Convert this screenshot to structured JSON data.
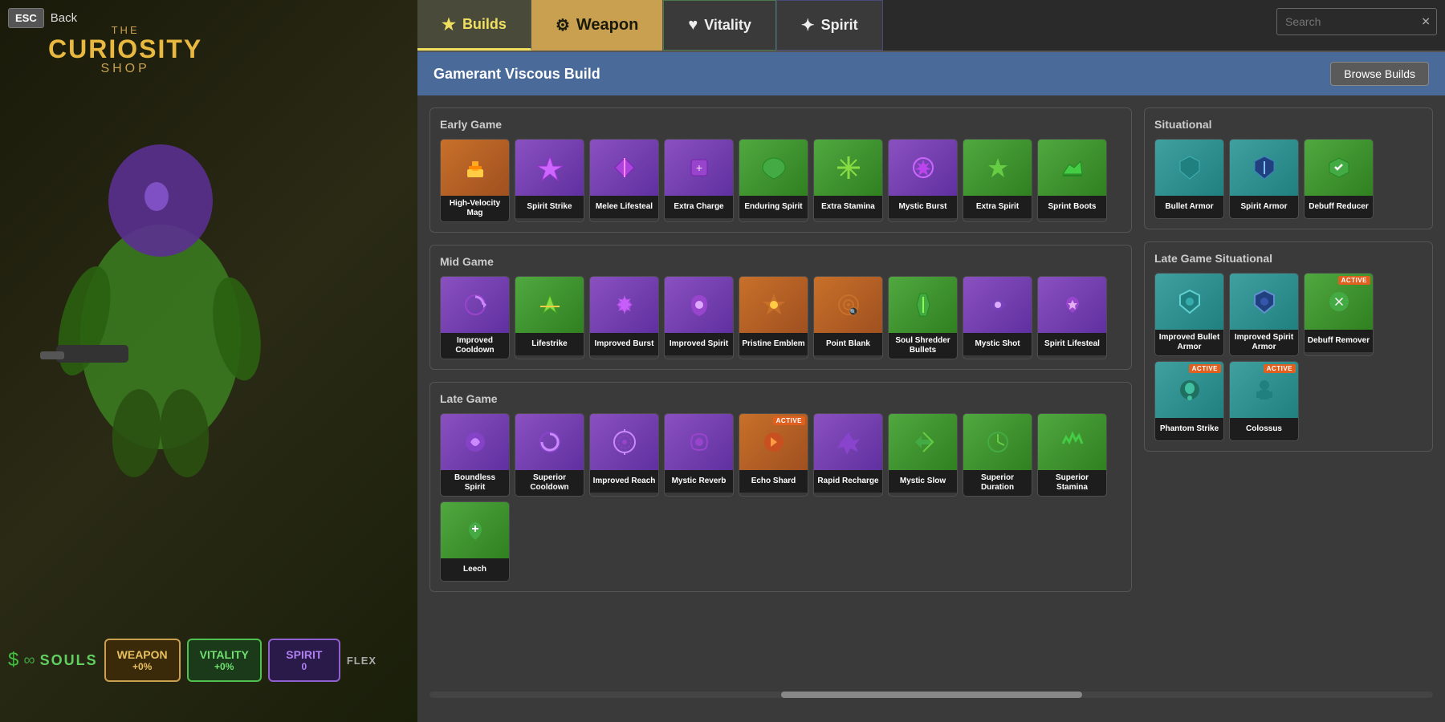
{
  "app": {
    "title": "The Curiosity Shop",
    "the_label": "THE",
    "curiosity_label": "CURIOSITY",
    "shop_label": "SHOP"
  },
  "top_bar": {
    "esc_label": "ESC",
    "back_label": "Back"
  },
  "tabs": {
    "builds_label": "Builds",
    "weapon_label": "Weapon",
    "vitality_label": "Vitality",
    "spirit_label": "Spirit"
  },
  "search": {
    "placeholder": "Search",
    "clear_icon": "✕"
  },
  "build": {
    "title": "Gamerant Viscous Build",
    "browse_builds_label": "Browse Builds"
  },
  "stats": {
    "souls_label": "SOULS",
    "weapon_label": "WEAPON",
    "weapon_val": "+0%",
    "vitality_label": "VITALITY",
    "vitality_val": "+0%",
    "spirit_label": "SPIRIT",
    "spirit_val": "0",
    "flex_label": "FLEX"
  },
  "sections": {
    "early_game_label": "Early Game",
    "mid_game_label": "Mid Game",
    "late_game_label": "Late Game",
    "situational_label": "Situational",
    "late_game_situational_label": "Late Game Situational"
  },
  "early_game_items": [
    {
      "name": "High-Velocity Mag",
      "color": "orange",
      "icon": "🔫"
    },
    {
      "name": "Spirit Strike",
      "color": "purple",
      "icon": "✦"
    },
    {
      "name": "Melee Lifesteal",
      "color": "purple",
      "icon": "⚔"
    },
    {
      "name": "Extra Charge",
      "color": "purple",
      "icon": "🔋"
    },
    {
      "name": "Enduring Spirit",
      "color": "green",
      "icon": "♥"
    },
    {
      "name": "Extra Stamina",
      "color": "green",
      "icon": "✱"
    },
    {
      "name": "Mystic Burst",
      "color": "purple",
      "icon": "✶"
    },
    {
      "name": "Extra Spirit",
      "color": "green",
      "icon": "✦"
    },
    {
      "name": "Sprint Boots",
      "color": "green",
      "icon": "👟"
    }
  ],
  "mid_game_items": [
    {
      "name": "Improved Cooldown",
      "color": "purple",
      "icon": "↺"
    },
    {
      "name": "Lifestrike",
      "color": "green",
      "icon": "⚡"
    },
    {
      "name": "Improved Burst",
      "color": "purple",
      "icon": "💫"
    },
    {
      "name": "Improved Spirit",
      "color": "purple",
      "icon": "🌀"
    },
    {
      "name": "Pristine Emblem",
      "color": "orange",
      "icon": "🛡"
    },
    {
      "name": "Point Blank",
      "color": "orange",
      "icon": "🎯"
    },
    {
      "name": "Soul Shredder Bullets",
      "color": "green",
      "icon": "🌿"
    },
    {
      "name": "Mystic Shot",
      "color": "purple",
      "icon": "☁"
    },
    {
      "name": "Spirit Lifesteal",
      "color": "purple",
      "icon": "💠"
    }
  ],
  "late_game_items": [
    {
      "name": "Boundless Spirit",
      "color": "purple",
      "icon": "🌸"
    },
    {
      "name": "Superior Cooldown",
      "color": "purple",
      "icon": "♾"
    },
    {
      "name": "Improved Reach",
      "color": "purple",
      "icon": "📡"
    },
    {
      "name": "Mystic Reverb",
      "color": "purple",
      "icon": "🎵"
    },
    {
      "name": "Echo Shard",
      "color": "orange",
      "icon": "💠",
      "active": true
    },
    {
      "name": "Rapid Recharge",
      "color": "purple",
      "icon": "⚡"
    },
    {
      "name": "Mystic Slow",
      "color": "green",
      "icon": "❄"
    },
    {
      "name": "Superior Duration",
      "color": "green",
      "icon": "⏱"
    },
    {
      "name": "Superior Stamina",
      "color": "green",
      "icon": "🌿"
    },
    {
      "name": "Leech",
      "color": "green",
      "icon": "🩸"
    }
  ],
  "situational_items": [
    {
      "name": "Bullet Armor",
      "color": "teal",
      "icon": "🛡"
    },
    {
      "name": "Spirit Armor",
      "color": "teal",
      "icon": "🛡"
    },
    {
      "name": "Debuff Reducer",
      "color": "green",
      "icon": "⬇"
    }
  ],
  "late_situational_items": [
    {
      "name": "Improved Bullet Armor",
      "color": "teal",
      "icon": "🛡"
    },
    {
      "name": "Improved Spirit Armor",
      "color": "teal",
      "icon": "🛡"
    },
    {
      "name": "Debuff Remover",
      "color": "green",
      "icon": "🔄",
      "active": true
    },
    {
      "name": "Phantom Strike",
      "color": "teal",
      "icon": "👁",
      "active": true
    },
    {
      "name": "Colossus",
      "color": "teal",
      "icon": "🤖",
      "active": true
    }
  ]
}
